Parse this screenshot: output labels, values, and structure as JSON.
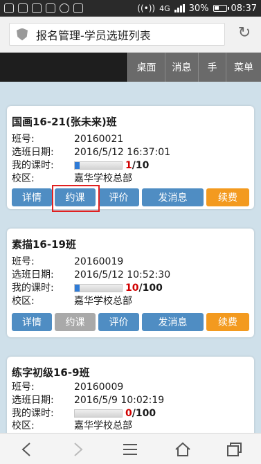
{
  "status_bar": {
    "network": "4G",
    "battery": "30%",
    "time": "08:37"
  },
  "browser": {
    "title": "报名管理-学员选班列表"
  },
  "nav": {
    "items": [
      "桌面",
      "消息",
      "手",
      "菜单"
    ]
  },
  "labels": {
    "class_no": "班号:",
    "select_date": "选班日期:",
    "my_hours": "我的课时:",
    "campus": "校区:"
  },
  "buttons": {
    "detail": "详情",
    "book": "约课",
    "review": "评价",
    "message": "发消息",
    "renew": "续费"
  },
  "cards": [
    {
      "title": "国画16-21(张未来)班",
      "class_no": "20160021",
      "select_date": "2016/5/12 16:37:01",
      "hours_used": "1",
      "hours_total": "/10",
      "progress": 0.1,
      "campus": "嘉华学校总部",
      "book_enabled": true
    },
    {
      "title": "素描16-19班",
      "class_no": "20160019",
      "select_date": "2016/5/12 10:52:30",
      "hours_used": "10",
      "hours_total": "/100",
      "progress": 0.1,
      "campus": "嘉华学校总部",
      "book_enabled": false
    },
    {
      "title": "练字初级16-9班",
      "class_no": "20160009",
      "select_date": "2016/5/9 10:02:19",
      "hours_used": "0",
      "hours_total": "/100",
      "progress": 0,
      "campus": "嘉华学校总部",
      "book_enabled": true
    }
  ],
  "colors": {
    "blue_button": "#4f8dc3",
    "gray_button": "#a9a9a9",
    "orange_button": "#f39a1f",
    "highlight": "#e02020",
    "progress_fill": "#2f7bd6"
  },
  "bottom_nav": [
    "back-icon",
    "forward-icon",
    "menu-icon",
    "home-icon",
    "tabs-icon"
  ]
}
